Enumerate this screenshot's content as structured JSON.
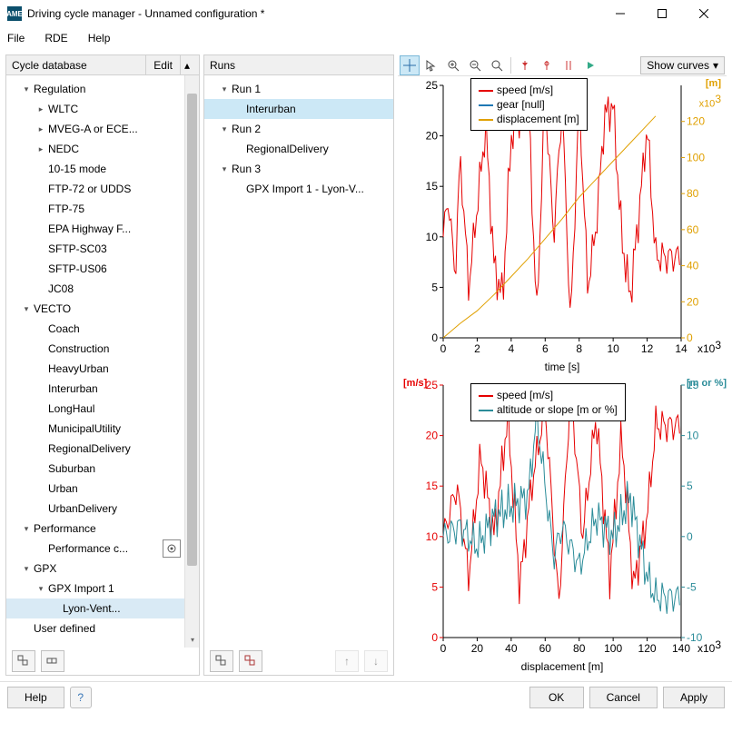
{
  "window": {
    "title": "Driving cycle manager - Unnamed configuration *"
  },
  "menu": {
    "file": "File",
    "rde": "RDE",
    "help": "Help"
  },
  "panels": {
    "cycle_db": {
      "title": "Cycle database",
      "edit": "Edit"
    },
    "runs": {
      "title": "Runs"
    }
  },
  "tree": {
    "regulation": "Regulation",
    "wltc": "WLTC",
    "mveg": "MVEG-A or ECE...",
    "nedc": "NEDC",
    "mode1015": "10-15 mode",
    "ftp72": "FTP-72 or UDDS",
    "ftp75": "FTP-75",
    "epa": "EPA Highway F...",
    "sftp03": "SFTP-SC03",
    "sftp06": "SFTP-US06",
    "jc08": "JC08",
    "vecto": "VECTO",
    "coach": "Coach",
    "construction": "Construction",
    "heavy": "HeavyUrban",
    "interurban": "Interurban",
    "longhaul": "LongHaul",
    "municipal": "MunicipalUtility",
    "regional": "RegionalDelivery",
    "suburban": "Suburban",
    "urban": "Urban",
    "urbandel": "UrbanDelivery",
    "perf": "Performance",
    "perfc": "Performance c...",
    "gpx": "GPX",
    "gpximp": "GPX Import 1",
    "lyon": "Lyon-Vent...",
    "userdef": "User defined"
  },
  "runs": {
    "r1": "Run 1",
    "r1_inter": "Interurban",
    "r2": "Run 2",
    "r2_reg": "RegionalDelivery",
    "r3": "Run 3",
    "r3_gpx": "GPX Import 1 - Lyon-V..."
  },
  "toolbar": {
    "show_curves": "Show curves"
  },
  "chart_data": [
    {
      "type": "line",
      "title": "",
      "xlabel": "time [s]",
      "x_unit_suffix": "x10^3",
      "xlim": [
        0,
        14
      ],
      "ylabel_left": "",
      "ylim_left": [
        0,
        25
      ],
      "ylabel_right": "[m]",
      "y_right_suffix": "x10^3",
      "ylim_right": [
        0,
        140
      ],
      "x_ticks": [
        0,
        2,
        4,
        6,
        8,
        10,
        12,
        14
      ],
      "y_ticks_left": [
        0,
        5,
        10,
        15,
        20,
        25
      ],
      "y_ticks_right": [
        0,
        20,
        40,
        60,
        80,
        100,
        120
      ],
      "legend": [
        "speed [m/s]",
        "gear [null]",
        "displacement [m]"
      ],
      "series": [
        {
          "name": "speed [m/s]",
          "color": "#e60000",
          "axis": "left",
          "x": [
            0,
            0.3,
            0.7,
            1,
            1.5,
            2,
            2.5,
            3,
            3.5,
            4,
            4.5,
            5,
            5.5,
            6,
            6.5,
            7,
            7.5,
            8,
            8.5,
            9,
            9.5,
            10,
            10.5,
            11,
            11.5,
            12,
            12.5
          ],
          "y": [
            10,
            14,
            6,
            18,
            5,
            13,
            21,
            7,
            4,
            20,
            22,
            24,
            2,
            24,
            10,
            23,
            1,
            24,
            5,
            11,
            22,
            23,
            10,
            4,
            12,
            21,
            8
          ]
        },
        {
          "name": "gear [null]",
          "color": "#1f78b4",
          "axis": "left",
          "x": [],
          "y": []
        },
        {
          "name": "displacement [m]",
          "color": "#e0a000",
          "axis": "right",
          "x": [
            0,
            1,
            2,
            3,
            4,
            5,
            6,
            7,
            8,
            9,
            10,
            11,
            12,
            12.5
          ],
          "y": [
            0,
            8,
            15,
            24,
            34,
            44,
            55,
            66,
            78,
            88,
            98,
            108,
            118,
            123
          ]
        }
      ]
    },
    {
      "type": "line",
      "title": "",
      "xlabel": "displacement [m]",
      "x_unit_suffix": "x10^3",
      "xlim": [
        0,
        140
      ],
      "ylabel_left": "[m/s]",
      "ylim_left": [
        0,
        25
      ],
      "ylabel_right": "[m or %]",
      "ylim_right": [
        -10,
        15
      ],
      "x_ticks": [
        0,
        20,
        40,
        60,
        80,
        100,
        120,
        140
      ],
      "y_ticks_left": [
        0,
        5,
        10,
        15,
        20,
        25
      ],
      "y_ticks_right": [
        -10,
        -5,
        0,
        5,
        10,
        15
      ],
      "legend": [
        "speed [m/s]",
        "altitude or slope [m or %]"
      ],
      "series": [
        {
          "name": "speed [m/s]",
          "color": "#e60000",
          "axis": "left",
          "x": [
            0,
            8,
            15,
            22,
            30,
            38,
            45,
            52,
            60,
            68,
            75,
            82,
            90,
            98,
            105,
            112,
            120,
            125
          ],
          "y": [
            10,
            15,
            6,
            18,
            10,
            22,
            5,
            15,
            23,
            3,
            25,
            10,
            22,
            6,
            20,
            5,
            12,
            21
          ]
        },
        {
          "name": "altitude or slope [m or %]",
          "color": "#2b8c99",
          "axis": "right",
          "x": [
            0,
            10,
            20,
            30,
            40,
            50,
            55,
            60,
            65,
            70,
            80,
            90,
            100,
            110,
            120,
            125
          ],
          "y": [
            0,
            1,
            -1,
            2,
            3,
            4,
            12,
            5,
            -2,
            1,
            -3,
            2,
            0,
            4,
            -4,
            -6
          ]
        }
      ]
    }
  ],
  "footer": {
    "help": "Help",
    "ok": "OK",
    "cancel": "Cancel",
    "apply": "Apply"
  }
}
